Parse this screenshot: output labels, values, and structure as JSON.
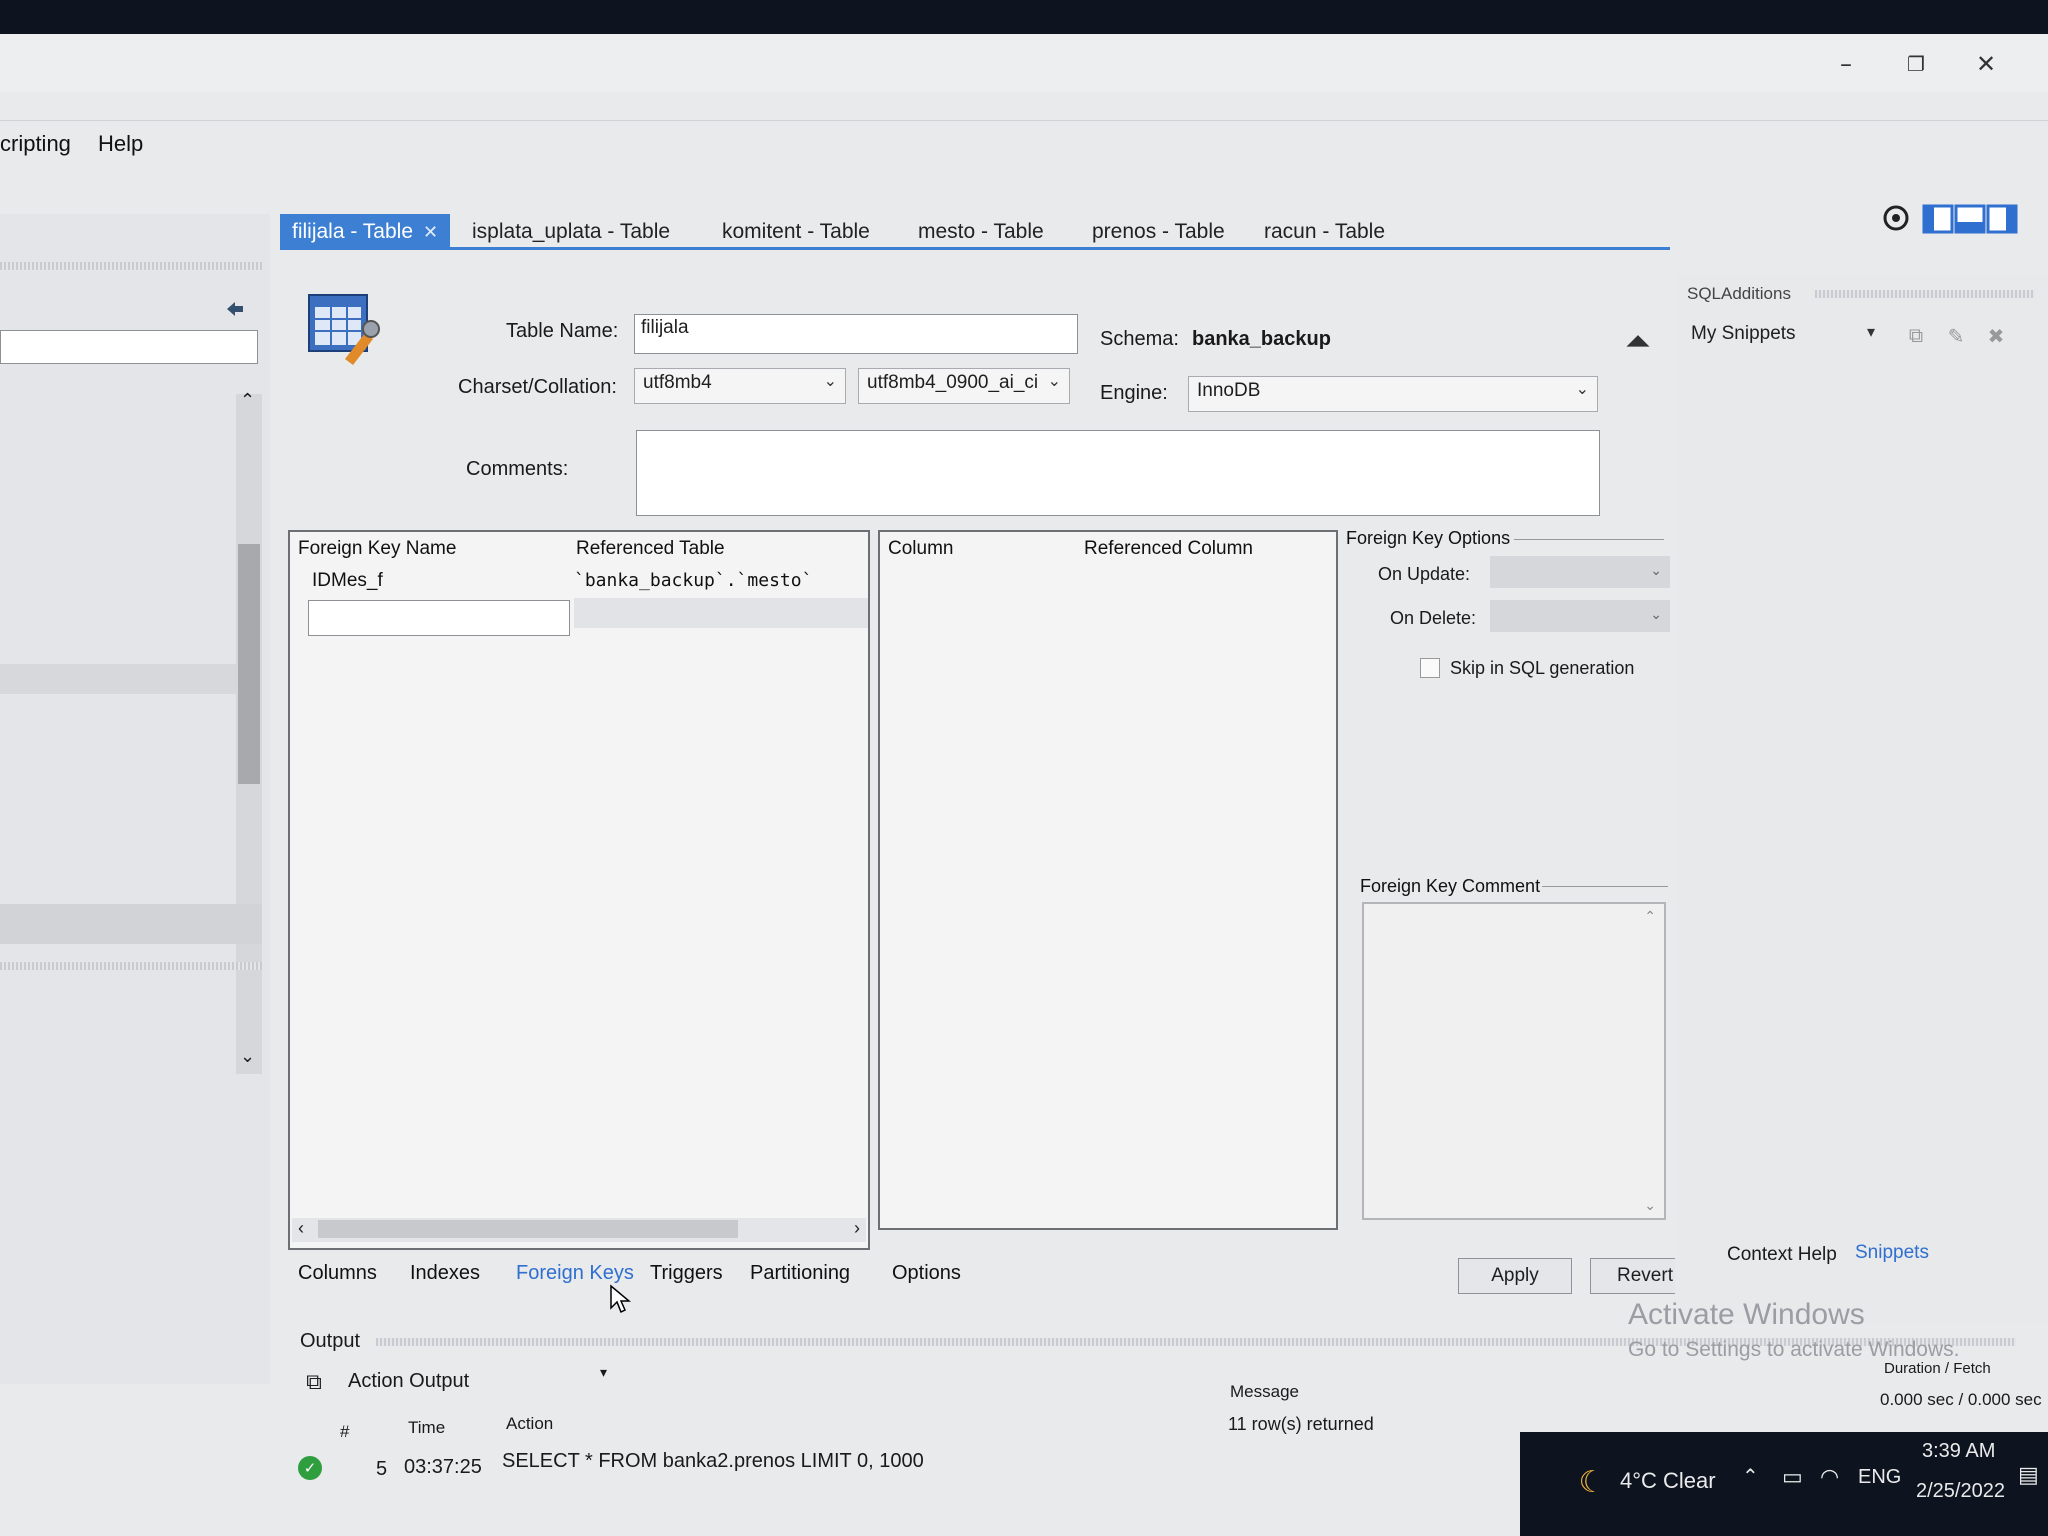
{
  "menu": {
    "items": [
      "cripting",
      "Help"
    ]
  },
  "window_controls": {
    "minimize": "–",
    "restore": "❐",
    "close": "✕"
  },
  "document_tabs": [
    {
      "label": "filijala - Table",
      "active": true,
      "closable": true
    },
    {
      "label": "isplata_uplata - Table",
      "active": false
    },
    {
      "label": "komitent - Table",
      "active": false
    },
    {
      "label": "mesto - Table",
      "active": false
    },
    {
      "label": "prenos - Table",
      "active": false
    },
    {
      "label": "racun - Table",
      "active": false
    }
  ],
  "table_editor": {
    "table_name_label": "Table Name:",
    "table_name_value": "filijala",
    "schema_label": "Schema:",
    "schema_value": "banka_backup",
    "charset_label": "Charset/Collation:",
    "charset_value": "utf8mb4",
    "collation_value": "utf8mb4_0900_ai_ci",
    "engine_label": "Engine:",
    "engine_value": "InnoDB",
    "comments_label": "Comments:",
    "comments_value": ""
  },
  "fk_list": {
    "columns": [
      "Foreign Key Name",
      "Referenced Table"
    ],
    "rows": [
      {
        "name": "IDMes_f",
        "referenced_table": "`banka_backup`.`mesto`"
      }
    ]
  },
  "fk_columns": {
    "columns": [
      "Column",
      "Referenced Column"
    ]
  },
  "fk_options": {
    "title": "Foreign Key Options",
    "on_update_label": "On Update:",
    "on_delete_label": "On Delete:",
    "skip_label": "Skip in SQL generation",
    "comment_title": "Foreign Key Comment"
  },
  "bottom_tabs": [
    {
      "label": "Columns",
      "active": false
    },
    {
      "label": "Indexes",
      "active": false
    },
    {
      "label": "Foreign Keys",
      "active": true
    },
    {
      "label": "Triggers",
      "active": false
    },
    {
      "label": "Partitioning",
      "active": false
    },
    {
      "label": "Options",
      "active": false
    }
  ],
  "buttons": {
    "apply": "Apply",
    "revert": "Revert"
  },
  "right_pane": {
    "title": "SQLAdditions",
    "snippets_select": "My Snippets",
    "tab_context_help": "Context Help",
    "tab_snippets": "Snippets"
  },
  "output": {
    "title": "Output",
    "selector": "Action Output",
    "columns": {
      "num": "#",
      "time": "Time",
      "action": "Action",
      "message": "Message",
      "duration": "Duration / Fetch"
    },
    "rows": [
      {
        "status": "ok",
        "num": "5",
        "time": "03:37:25",
        "action": "SELECT * FROM banka2.prenos LIMIT 0, 1000",
        "message": "11 row(s) returned",
        "duration": "0.000 sec / 0.000 sec"
      }
    ]
  },
  "watermark": {
    "line1": "Activate Windows",
    "line2": "Go to Settings to activate Windows."
  },
  "taskbar": {
    "weather": "4°C  Clear",
    "language": "ENG",
    "time": "3:39 AM",
    "date": "2/25/2022"
  },
  "colors": {
    "accent": "#3c7fd3",
    "ok": "#2e9e3e"
  }
}
